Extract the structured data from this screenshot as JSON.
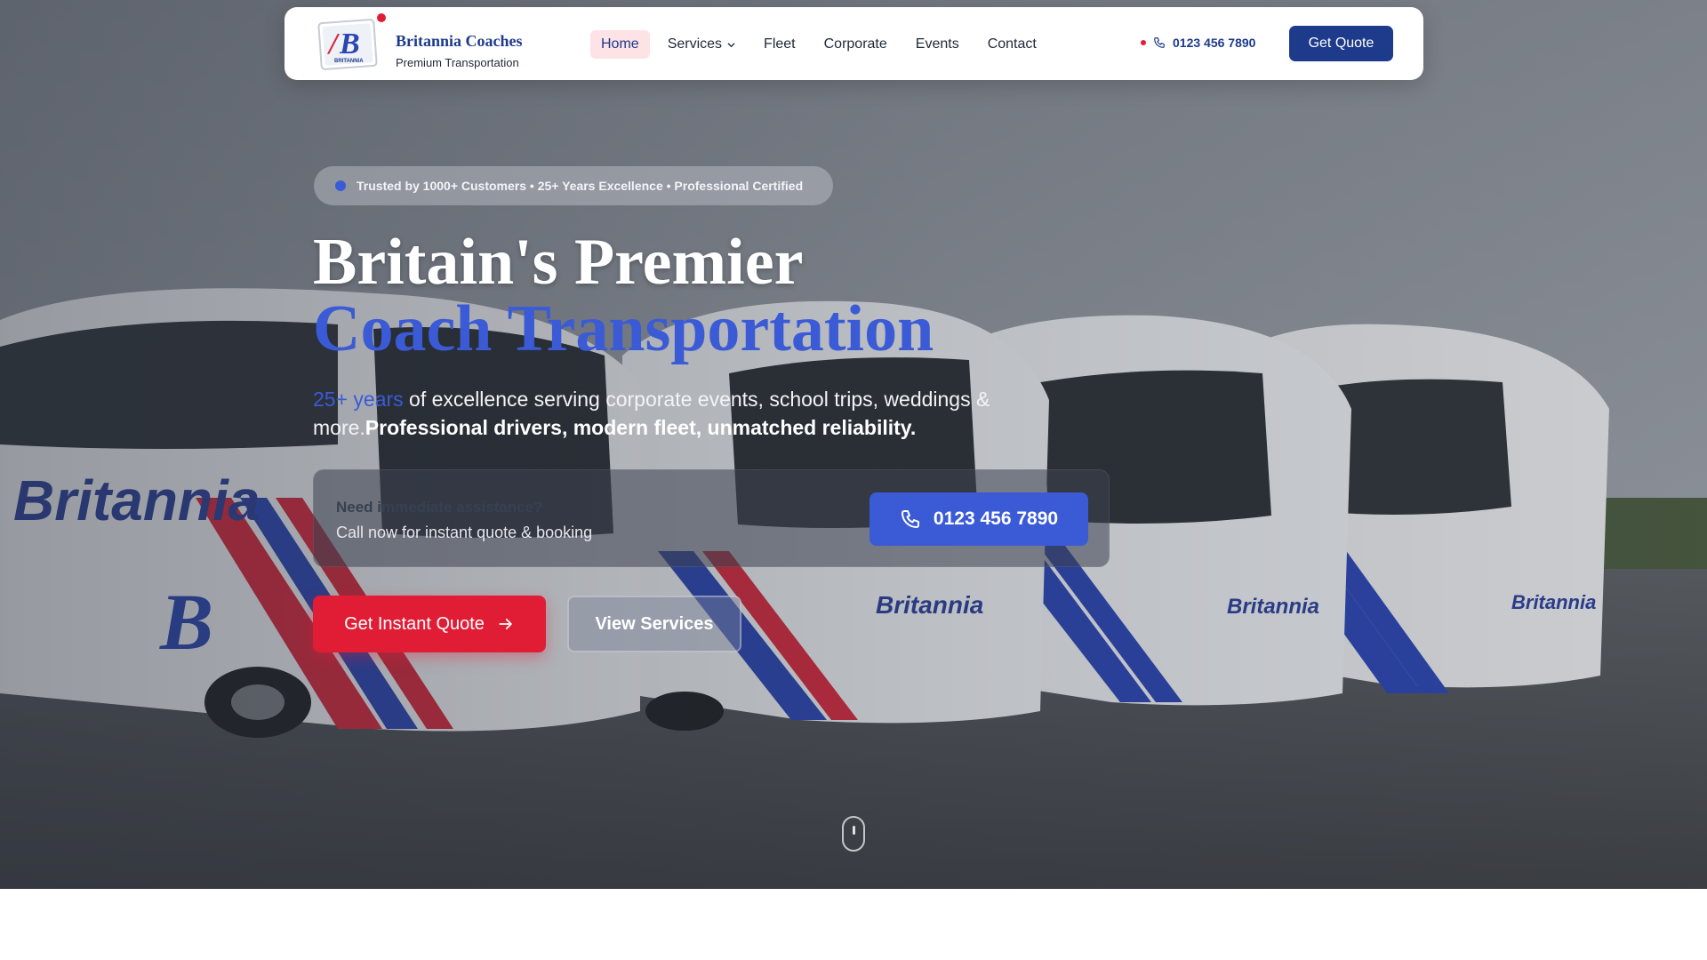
{
  "brand": {
    "name": "Britannia Coaches",
    "tagline": "Premium Transportation",
    "logo_text": "BRITANNIA"
  },
  "nav": {
    "items": [
      {
        "label": "Home",
        "active": true
      },
      {
        "label": "Services",
        "has_dropdown": true
      },
      {
        "label": "Fleet"
      },
      {
        "label": "Corporate"
      },
      {
        "label": "Events"
      },
      {
        "label": "Contact"
      }
    ],
    "phone": "0123 456 7890",
    "cta_label": "Get Quote"
  },
  "hero": {
    "trust_text": "Trusted by 1000+ Customers • 25+ Years Excellence • Professional Certified",
    "title_line1": "Britain's Premier",
    "title_line2": "Coach Transportation",
    "lead_accent": "25+ years",
    "lead_text": " of excellence serving corporate events, school trips, weddings & more.",
    "lead_strong": "Professional drivers, modern fleet, unmatched reliability.",
    "assist_title": "Need immediate assistance?",
    "assist_subtitle": "Call now for instant quote & booking",
    "call_phone": "0123 456 7890",
    "primary_cta": "Get Instant Quote",
    "secondary_cta": "View Services",
    "bus_branding": "Britannia"
  },
  "colors": {
    "brand_blue": "#1e3a8a",
    "accent_blue": "#3b5bd6",
    "brand_red": "#e11d36",
    "active_nav_bg": "#fde2e6"
  },
  "icons": {
    "phone": "phone-icon",
    "arrow": "arrow-right-icon",
    "chevron": "chevron-down-icon",
    "scroll": "mouse-scroll-icon"
  }
}
